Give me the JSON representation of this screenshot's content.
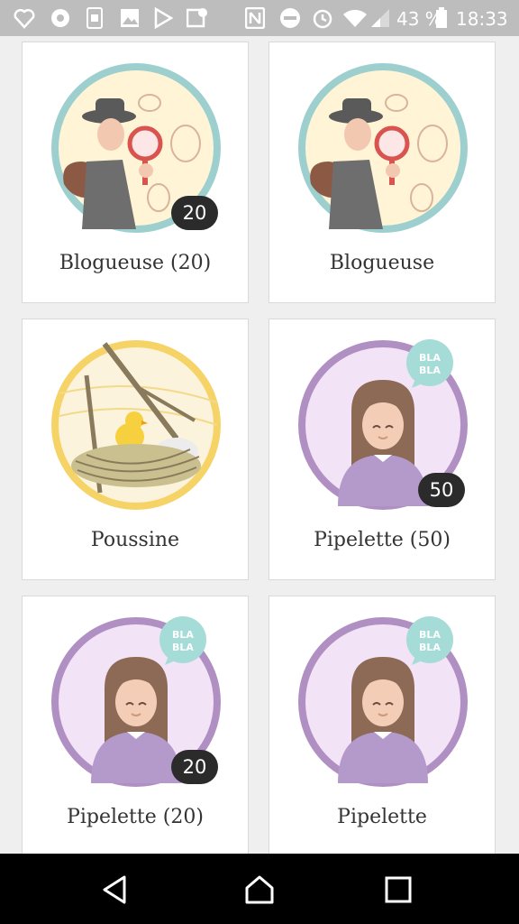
{
  "status_bar": {
    "battery_percent": "43 %",
    "time": "18:33",
    "icons": [
      "heart-notification-icon",
      "chrome-icon",
      "sim-icon",
      "image-icon",
      "play-store-icon",
      "photo-location-icon",
      "nfc-icon",
      "do-not-disturb-icon",
      "alarm-icon",
      "wifi-icon",
      "signal-icon",
      "battery-icon"
    ]
  },
  "badges": [
    {
      "label": "Blogueuse (20)",
      "count": "20",
      "type": "detective",
      "ring": "#9ccfce"
    },
    {
      "label": "Blogueuse",
      "count": "",
      "type": "detective",
      "ring": "#9ccfce"
    },
    {
      "label": "Poussine",
      "count": "",
      "type": "nest",
      "ring": "#f6d366"
    },
    {
      "label": "Pipelette (50)",
      "count": "50",
      "type": "chatter",
      "ring": "#b08fc2",
      "bubble": "BLA BLA"
    },
    {
      "label": "Pipelette (20)",
      "count": "20",
      "type": "chatter",
      "ring": "#b08fc2",
      "bubble": "BLA BLA"
    },
    {
      "label": "Pipelette",
      "count": "",
      "type": "chatter",
      "ring": "#b08fc2",
      "bubble": "BLA BLA"
    }
  ],
  "bubble_text": {
    "line1": "BLA",
    "line2": "BLA"
  },
  "nav": [
    "back-icon",
    "home-icon",
    "recents-icon"
  ]
}
